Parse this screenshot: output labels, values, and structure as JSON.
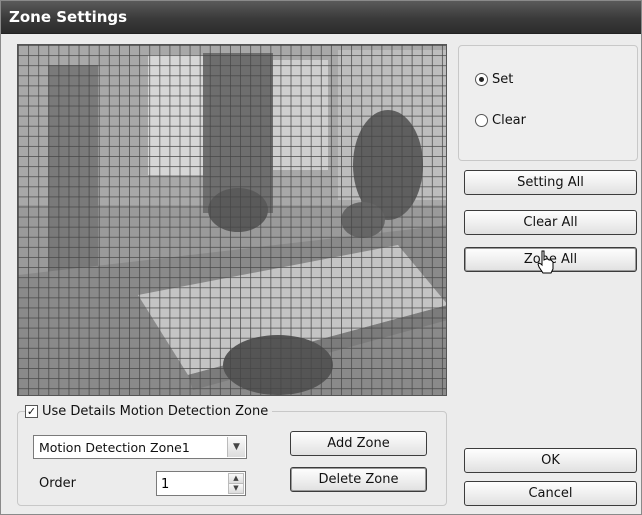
{
  "window": {
    "title": "Zone Settings"
  },
  "mode": {
    "options": [
      {
        "label": "Set",
        "checked": true
      },
      {
        "label": "Clear",
        "checked": false
      }
    ]
  },
  "buttons": {
    "setting_all": "Setting All",
    "clear_all": "Clear All",
    "zone_all": "Zone All",
    "add_zone": "Add Zone",
    "delete_zone": "Delete Zone",
    "ok": "OK",
    "cancel": "Cancel"
  },
  "details": {
    "use_details_label": "Use Details Motion Detection Zone",
    "use_details_checked": true,
    "zone_select_value": "Motion Detection Zone1",
    "order_label": "Order",
    "order_value": "1"
  },
  "icons": {
    "select_arrow": "chevron-down-icon",
    "spin_up": "chevron-up-icon",
    "spin_down": "chevron-down-icon",
    "cursor": "hand-pointer-icon"
  }
}
